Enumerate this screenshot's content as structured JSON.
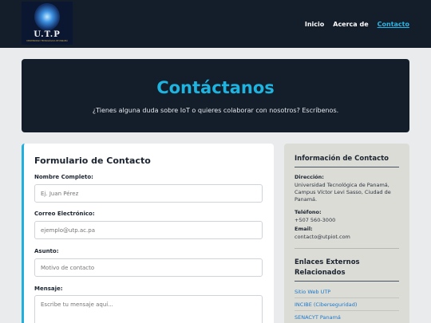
{
  "header": {
    "logo_text": "U.T.P",
    "logo_tagline": "UNIVERSIDAD TECNOLÓGICA DE PANAMÁ",
    "nav": [
      {
        "label": "Inicio",
        "active": false
      },
      {
        "label": "Acerca de",
        "active": false
      },
      {
        "label": "Contacto",
        "active": true
      }
    ]
  },
  "hero": {
    "title": "Contáctanos",
    "subtitle": "¿Tienes alguna duda sobre IoT o quieres colaborar con nosotros? Escríbenos."
  },
  "form": {
    "title": "Formulario de Contacto",
    "fields": [
      {
        "label": "Nombre Completo:",
        "placeholder": "Ej. Juan Pérez"
      },
      {
        "label": "Correo Electrónico:",
        "placeholder": "ejemplo@utp.ac.pa"
      },
      {
        "label": "Asunto:",
        "placeholder": "Motivo de contacto"
      },
      {
        "label": "Mensaje:",
        "placeholder": "Escribe tu mensaje aquí..."
      }
    ]
  },
  "info": {
    "title": "Información de Contacto",
    "direccion_label": "Dirección:",
    "direccion_value": "Universidad Tecnológica de Panamá, Campus Víctor Levi Sasso, Ciudad de Panamá.",
    "telefono_label": "Teléfono:",
    "telefono_value": "+507 560-3000",
    "email_label": "Email:",
    "email_value": "contacto@utpiot.com",
    "links_title": "Enlaces Externos Relacionados",
    "links": [
      "Sitio Web UTP",
      "INCIBE (Ciberseguridad)",
      "SENACYT Panamá"
    ]
  },
  "colors": {
    "header_bg": "#141d2a",
    "accent": "#1fb3e0",
    "link": "#1b77c8"
  }
}
